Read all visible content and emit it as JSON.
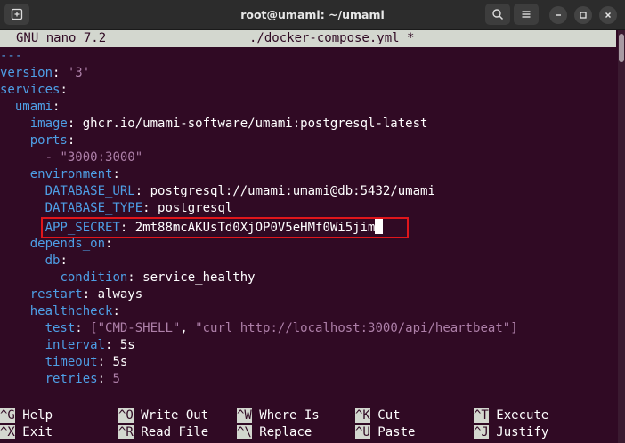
{
  "window": {
    "title": "root@umami: ~/umami"
  },
  "nano": {
    "version": "GNU nano 7.2",
    "filename": "./docker-compose.yml *"
  },
  "editor": {
    "line_doc_start": "---",
    "version_key": "version",
    "version_value": "'3'",
    "services_key": "services",
    "umami_key": "umami",
    "image_key": "image",
    "image_value": "ghcr.io/umami-software/umami:postgresql-latest",
    "ports_key": "ports",
    "port_item": "\"3000:3000\"",
    "environment_key": "environment",
    "db_url_key": "DATABASE_URL",
    "db_url_value": "postgresql://umami:umami@db:5432/umami",
    "db_type_key": "DATABASE_TYPE",
    "db_type_value": "postgresql",
    "app_secret_key": "APP_SECRET",
    "app_secret_value": "2mt88mcAKUsTd0XjOP0V5eHMf0Wi5jim",
    "depends_on_key": "depends_on",
    "db_key": "db",
    "condition_key": "condition",
    "condition_value": "service_healthy",
    "restart_key": "restart",
    "restart_value": "always",
    "healthcheck_key": "healthcheck",
    "test_key": "test",
    "test_item_1": "\"CMD-SHELL\"",
    "test_item_2": "\"curl http://localhost:3000/api/heartbeat\"",
    "interval_key": "interval",
    "interval_value": "5s",
    "timeout_key": "timeout",
    "timeout_value": "5s",
    "retries_key": "retries",
    "retries_value": "5"
  },
  "shortcuts": [
    {
      "key": "^G",
      "label": "Help"
    },
    {
      "key": "^O",
      "label": "Write Out"
    },
    {
      "key": "^W",
      "label": "Where Is"
    },
    {
      "key": "^K",
      "label": "Cut"
    },
    {
      "key": "^T",
      "label": "Execute"
    },
    {
      "key": "^X",
      "label": "Exit"
    },
    {
      "key": "^R",
      "label": "Read File"
    },
    {
      "key": "^\\",
      "label": "Replace"
    },
    {
      "key": "^U",
      "label": "Paste"
    },
    {
      "key": "^J",
      "label": "Justify"
    }
  ],
  "icons": {
    "new_tab": "new-tab-icon",
    "search": "search-icon",
    "menu": "hamburger-menu-icon",
    "minimize": "minimize-icon",
    "maximize": "maximize-icon",
    "close": "close-icon"
  },
  "colors": {
    "terminal_bg": "#300a24",
    "key": "#4e9fe6",
    "string": "#ad7fa8",
    "highlight": "#e0161b",
    "header_bar": "#d3d7cf"
  }
}
